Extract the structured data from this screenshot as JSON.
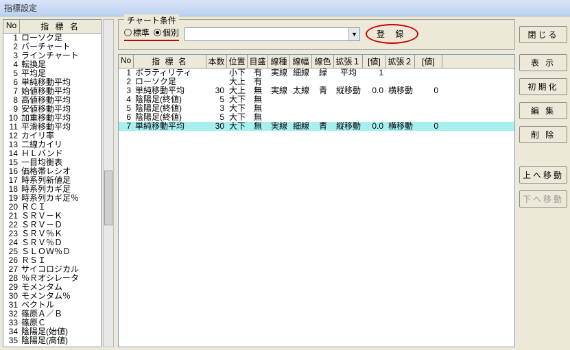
{
  "title": "指標設定",
  "leftList": {
    "header": {
      "no": "No",
      "name": "指 標 名"
    },
    "items": [
      {
        "no": 1,
        "name": "ローソク足"
      },
      {
        "no": 2,
        "name": "バーチャート"
      },
      {
        "no": 3,
        "name": "ラインチャート"
      },
      {
        "no": 4,
        "name": "転換足"
      },
      {
        "no": 5,
        "name": "平均足"
      },
      {
        "no": 6,
        "name": "単純移動平均"
      },
      {
        "no": 7,
        "name": "始値移動平均"
      },
      {
        "no": 8,
        "name": "高値移動平均"
      },
      {
        "no": 9,
        "name": "安値移動平均"
      },
      {
        "no": 10,
        "name": "加重移動平均"
      },
      {
        "no": 11,
        "name": "平滑移動平均"
      },
      {
        "no": 12,
        "name": "カイリ率"
      },
      {
        "no": 13,
        "name": "二線カイリ"
      },
      {
        "no": 14,
        "name": "ＨＬバンド"
      },
      {
        "no": 15,
        "name": "一目均衡表"
      },
      {
        "no": 16,
        "name": "価格帯レシオ"
      },
      {
        "no": 17,
        "name": "時系列新値足"
      },
      {
        "no": 18,
        "name": "時系列カギ足"
      },
      {
        "no": 19,
        "name": "時系列カギ足％"
      },
      {
        "no": 20,
        "name": "ＲＣＩ"
      },
      {
        "no": 21,
        "name": "ＳＲＶ－Ｋ"
      },
      {
        "no": 22,
        "name": "ＳＲＶ－Ｄ"
      },
      {
        "no": 23,
        "name": "ＳＲＶ％Ｋ"
      },
      {
        "no": 24,
        "name": "ＳＲＶ％Ｄ"
      },
      {
        "no": 25,
        "name": "ＳＬＯＷ％Ｄ"
      },
      {
        "no": 26,
        "name": "ＲＳＩ"
      },
      {
        "no": 27,
        "name": "サイコロジカル"
      },
      {
        "no": 28,
        "name": "％Ｒオシレータ"
      },
      {
        "no": 29,
        "name": "モメンタム"
      },
      {
        "no": 30,
        "name": "モメンタム％"
      },
      {
        "no": 31,
        "name": "ベクトル"
      },
      {
        "no": 32,
        "name": "篠原Ａ／Ｂ"
      },
      {
        "no": 33,
        "name": "篠原Ｃ"
      },
      {
        "no": 34,
        "name": "陰陽足(始値)"
      },
      {
        "no": 35,
        "name": "陰陽足(高値)"
      }
    ]
  },
  "chartCondition": {
    "title": "チャート条件",
    "options": {
      "standard": "標準",
      "individual": "個別"
    },
    "selected": "individual",
    "dropdown": "",
    "register": "登 録"
  },
  "mainTable": {
    "header": {
      "no": "No",
      "name": "指 標 名",
      "num": "本数",
      "pos": "位置",
      "scale": "目盛",
      "ltype": "線種",
      "lw": "線幅",
      "lc": "線色",
      "ext1": "拡張１",
      "val1": "[値]",
      "ext2": "拡張２",
      "val2": "[値]"
    },
    "rows": [
      {
        "no": 1,
        "name": "ボラティリティ",
        "num": "",
        "pos": "小下",
        "scale": "有",
        "ltype": "実線",
        "lw": "細線",
        "lc": "緑",
        "ext1": "平均",
        "val1": "1",
        "ext2": "",
        "val2": ""
      },
      {
        "no": 2,
        "name": "ローソク足",
        "num": "",
        "pos": "大上",
        "scale": "有",
        "ltype": "",
        "lw": "",
        "lc": "",
        "ext1": "",
        "val1": "",
        "ext2": "",
        "val2": ""
      },
      {
        "no": 3,
        "name": "単純移動平均",
        "num": "30",
        "pos": "大上",
        "scale": "無",
        "ltype": "実線",
        "lw": "太線",
        "lc": "青",
        "ext1": "縦移動",
        "val1": "0.0",
        "ext2": "横移動",
        "val2": "0"
      },
      {
        "no": 4,
        "name": "陰陽足(終値)",
        "num": "5",
        "pos": "大下",
        "scale": "無",
        "ltype": "",
        "lw": "",
        "lc": "",
        "ext1": "",
        "val1": "",
        "ext2": "",
        "val2": ""
      },
      {
        "no": 5,
        "name": "陰陽足(終値)",
        "num": "3",
        "pos": "大下",
        "scale": "無",
        "ltype": "",
        "lw": "",
        "lc": "",
        "ext1": "",
        "val1": "",
        "ext2": "",
        "val2": ""
      },
      {
        "no": 6,
        "name": "陰陽足(終値)",
        "num": "5",
        "pos": "大下",
        "scale": "無",
        "ltype": "",
        "lw": "",
        "lc": "",
        "ext1": "",
        "val1": "",
        "ext2": "",
        "val2": ""
      },
      {
        "no": 7,
        "name": "単純移動平均",
        "num": "30",
        "pos": "大下",
        "scale": "無",
        "ltype": "実線",
        "lw": "細線",
        "lc": "青",
        "ext1": "縦移動",
        "val1": "0.0",
        "ext2": "横移動",
        "val2": "0",
        "highlight": true
      }
    ]
  },
  "buttons": {
    "close": "閉じる",
    "show": "表 示",
    "init": "初期化",
    "edit": "編 集",
    "delete": "削 除",
    "moveUp": "上へ移動",
    "moveDown": "下へ移動"
  }
}
